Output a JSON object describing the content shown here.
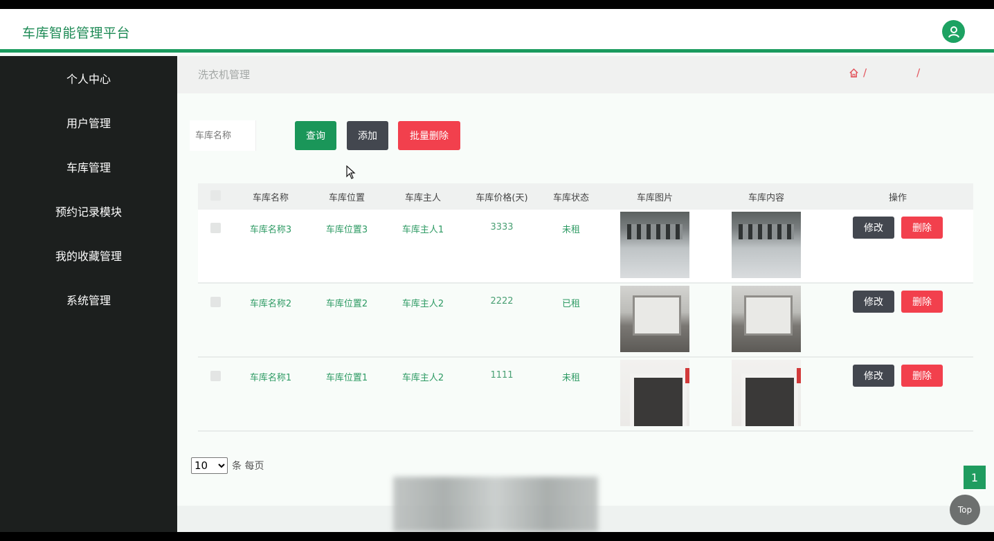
{
  "app": {
    "title": "车库智能管理平台"
  },
  "sidebar": {
    "items": [
      {
        "label": "个人中心"
      },
      {
        "label": "用户管理"
      },
      {
        "label": "车库管理"
      },
      {
        "label": "预约记录模块"
      },
      {
        "label": "我的收藏管理"
      },
      {
        "label": "系统管理"
      }
    ]
  },
  "breadcrumb": {
    "title": "洗衣机管理",
    "sep": "/",
    "home_icon": "home-icon"
  },
  "search": {
    "placeholder": "车库名称"
  },
  "toolbar": {
    "query_label": "查询",
    "add_label": "添加",
    "batch_delete_label": "批量删除"
  },
  "table": {
    "headers": [
      "车库名称",
      "车库位置",
      "车库主人",
      "车库价格(天)",
      "车库状态",
      "车库图片",
      "车库内容",
      "操作"
    ],
    "rows": [
      {
        "name": "车库名称3",
        "location": "车库位置3",
        "owner": "车库主人1",
        "price": "3333",
        "status": "未租",
        "image": "garage-ceiling-image"
      },
      {
        "name": "车库名称2",
        "location": "车库位置2",
        "owner": "车库主人2",
        "price": "2222",
        "status": "已租",
        "image": "garage-door-image"
      },
      {
        "name": "车库名称1",
        "location": "车库位置1",
        "owner": "车库主人2",
        "price": "1111",
        "status": "未租",
        "image": "garage-white-image"
      }
    ],
    "edit_label": "修改",
    "delete_label": "删除"
  },
  "pager": {
    "page_size": "10",
    "page_size_options": [
      "10"
    ],
    "per_page_label": "条 每页",
    "current_page": "1"
  },
  "back_to_top": {
    "label": "Top"
  },
  "colors": {
    "accent": "#1a9b5e",
    "danger": "#f2404d",
    "dark": "#43474f",
    "sidebar": "#1c1f1e"
  }
}
